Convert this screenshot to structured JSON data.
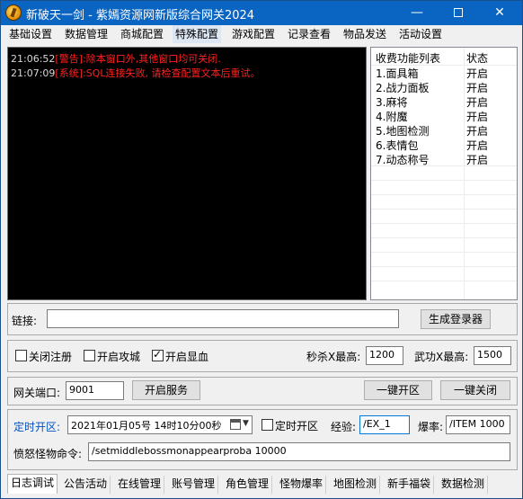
{
  "window": {
    "title": "新破天一剑 - 紫嫣资源网新版综合网关2024"
  },
  "menu": [
    {
      "label": "基础设置"
    },
    {
      "label": "数据管理"
    },
    {
      "label": "商城配置"
    },
    {
      "label": "特殊配置"
    },
    {
      "label": "游戏配置"
    },
    {
      "label": "记录查看"
    },
    {
      "label": "物品发送"
    },
    {
      "label": "活动设置"
    }
  ],
  "log": [
    {
      "time": "21:06:52",
      "text": "[警告]:除本窗口外,其他窗口均可关闭."
    },
    {
      "time": "21:07:09",
      "text": "[系统]:SQL连接失败, 请检查配置文本后重试。"
    }
  ],
  "features": {
    "header_name": "收费功能列表",
    "header_status": "状态",
    "rows": [
      {
        "name": "1.面具箱",
        "status": "开启"
      },
      {
        "name": "2.战力面板",
        "status": "开启"
      },
      {
        "name": "3.麻将",
        "status": "开启"
      },
      {
        "name": "4.附魔",
        "status": "开启"
      },
      {
        "name": "5.地图检测",
        "status": "开启"
      },
      {
        "name": "6.表情包",
        "status": "开启"
      },
      {
        "name": "7.动态称号",
        "status": "开启"
      }
    ]
  },
  "link": {
    "label": "链接:",
    "value": "",
    "generate_button": "生成登录器"
  },
  "options": {
    "close_register": "关闭注册",
    "open_siege": "开启攻城",
    "open_display": "开启显血",
    "close_register_checked": false,
    "open_siege_checked": false,
    "open_display_checked": true,
    "second_kill_label": "秒杀X最高:",
    "second_kill_value": "1200",
    "martial_label": "武功X最高:",
    "martial_value": "1500"
  },
  "gateway": {
    "port_label": "网关端口:",
    "port_value": "9001",
    "start_service": "开启服务",
    "one_click_open": "一键开区",
    "one_click_close": "一键关闭"
  },
  "schedule": {
    "timed_open_label": "定时开区:",
    "datetime_value": "2021年01月05号  14时10分00秒",
    "timed_open_checkbox": "定时开区",
    "timed_open_checked": false,
    "exp_label": "经验:",
    "exp_value": "/EX_1",
    "drop_label": "爆率:",
    "drop_value": "/ITEM 1000",
    "rage_label": "愤怒怪物命令:",
    "rage_value": "/setmiddlebossmonappearproba 10000"
  },
  "bottom_tabs": [
    {
      "label": "日志调试"
    },
    {
      "label": "公告活动"
    },
    {
      "label": "在线管理"
    },
    {
      "label": "账号管理"
    },
    {
      "label": "角色管理"
    },
    {
      "label": "怪物爆率"
    },
    {
      "label": "地图检测"
    },
    {
      "label": "新手福袋"
    },
    {
      "label": "数据检测"
    }
  ]
}
